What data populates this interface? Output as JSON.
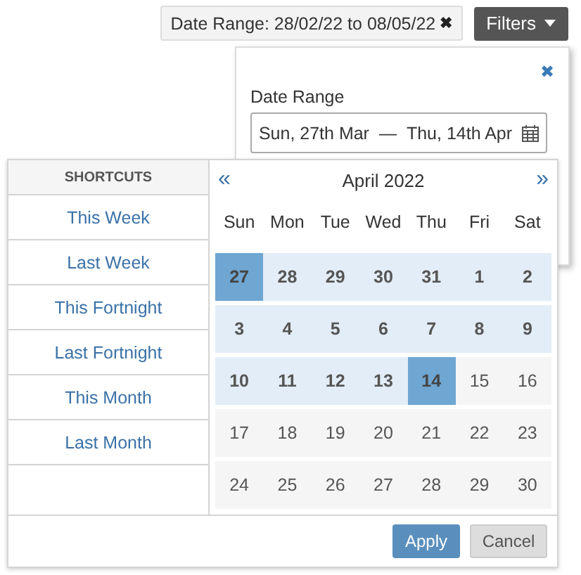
{
  "filter_chip": {
    "label": "Date Range: 28/02/22 to 08/05/22",
    "remove": "✖"
  },
  "filters_button": {
    "label": "Filters"
  },
  "filter_panel": {
    "close": "✖",
    "field_label": "Date Range",
    "start": "Sun, 27th Mar",
    "separator": "—",
    "end": "Thu, 14th Apr"
  },
  "date_picker": {
    "shortcuts_heading": "SHORTCUTS",
    "shortcuts": [
      {
        "label": "This Week"
      },
      {
        "label": "Last Week"
      },
      {
        "label": "This Fortnight"
      },
      {
        "label": "Last Fortnight"
      },
      {
        "label": "This Month"
      },
      {
        "label": "Last Month"
      }
    ],
    "prev": "«",
    "month": "April 2022",
    "next": "»",
    "weekdays": [
      "Sun",
      "Mon",
      "Tue",
      "Wed",
      "Thu",
      "Fri",
      "Sat"
    ],
    "weeks": [
      [
        {
          "day": "27",
          "in_range": true,
          "selected": true
        },
        {
          "day": "28",
          "in_range": true,
          "selected": false
        },
        {
          "day": "29",
          "in_range": true,
          "selected": false
        },
        {
          "day": "30",
          "in_range": true,
          "selected": false
        },
        {
          "day": "31",
          "in_range": true,
          "selected": false
        },
        {
          "day": "1",
          "in_range": true,
          "selected": false
        },
        {
          "day": "2",
          "in_range": true,
          "selected": false
        }
      ],
      [
        {
          "day": "3",
          "in_range": true,
          "selected": false
        },
        {
          "day": "4",
          "in_range": true,
          "selected": false
        },
        {
          "day": "5",
          "in_range": true,
          "selected": false
        },
        {
          "day": "6",
          "in_range": true,
          "selected": false
        },
        {
          "day": "7",
          "in_range": true,
          "selected": false
        },
        {
          "day": "8",
          "in_range": true,
          "selected": false
        },
        {
          "day": "9",
          "in_range": true,
          "selected": false
        }
      ],
      [
        {
          "day": "10",
          "in_range": true,
          "selected": false
        },
        {
          "day": "11",
          "in_range": true,
          "selected": false
        },
        {
          "day": "12",
          "in_range": true,
          "selected": false
        },
        {
          "day": "13",
          "in_range": true,
          "selected": false
        },
        {
          "day": "14",
          "in_range": true,
          "selected": true
        },
        {
          "day": "15",
          "in_range": false,
          "selected": false
        },
        {
          "day": "16",
          "in_range": false,
          "selected": false
        }
      ],
      [
        {
          "day": "17",
          "in_range": false,
          "selected": false
        },
        {
          "day": "18",
          "in_range": false,
          "selected": false
        },
        {
          "day": "19",
          "in_range": false,
          "selected": false
        },
        {
          "day": "20",
          "in_range": false,
          "selected": false
        },
        {
          "day": "21",
          "in_range": false,
          "selected": false
        },
        {
          "day": "22",
          "in_range": false,
          "selected": false
        },
        {
          "day": "23",
          "in_range": false,
          "selected": false
        }
      ],
      [
        {
          "day": "24",
          "in_range": false,
          "selected": false
        },
        {
          "day": "25",
          "in_range": false,
          "selected": false
        },
        {
          "day": "26",
          "in_range": false,
          "selected": false
        },
        {
          "day": "27",
          "in_range": false,
          "selected": false
        },
        {
          "day": "28",
          "in_range": false,
          "selected": false
        },
        {
          "day": "29",
          "in_range": false,
          "selected": false
        },
        {
          "day": "30",
          "in_range": false,
          "selected": false
        }
      ]
    ],
    "apply": "Apply",
    "cancel": "Cancel"
  }
}
